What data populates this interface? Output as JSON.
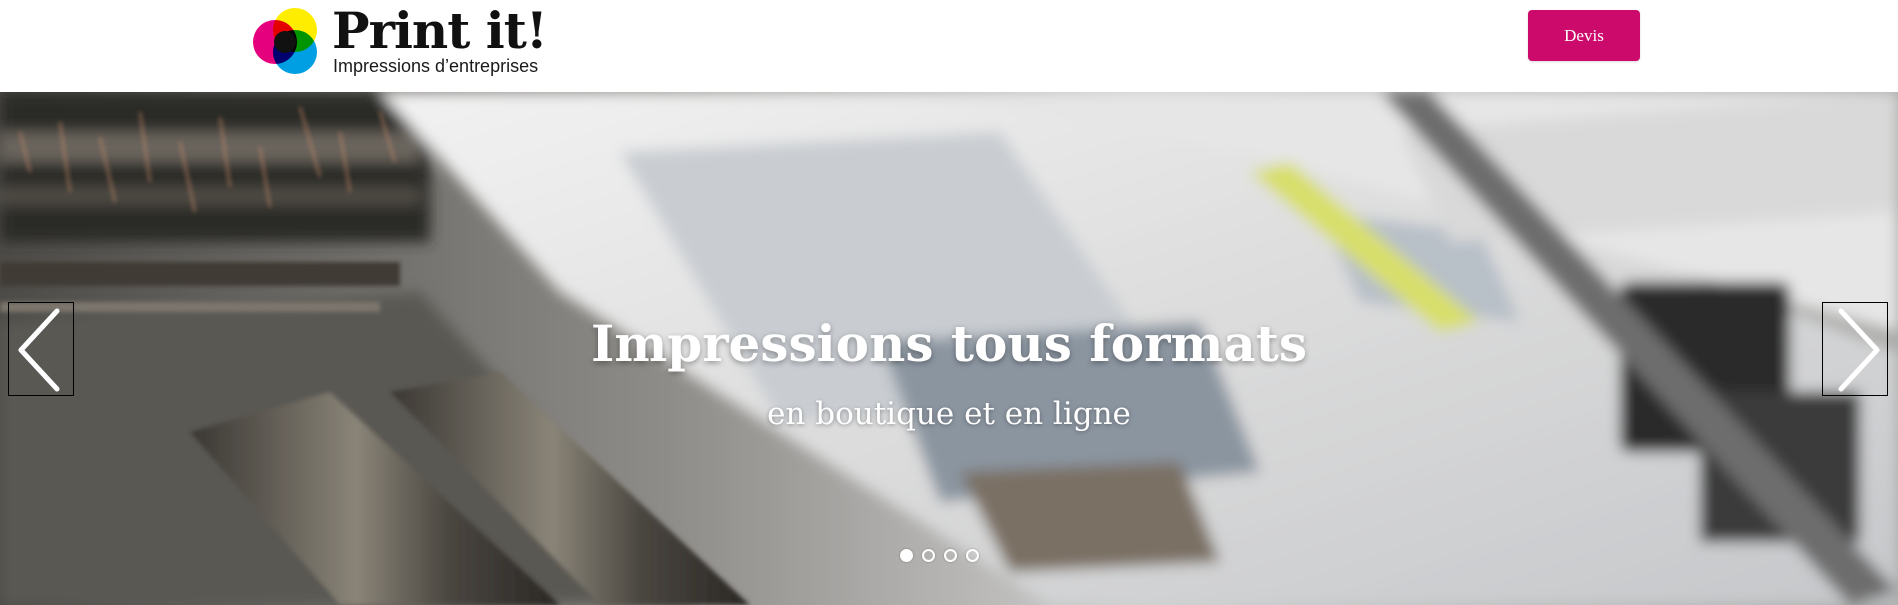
{
  "header": {
    "logo": {
      "title": "Print it!",
      "tagline": "Impressions d’entreprises",
      "colors": [
        "#e5007e",
        "#ffed00",
        "#009fe3",
        "#00963f",
        "#000000"
      ]
    },
    "devis_label": "Devis",
    "accent_color": "#cc0a6c"
  },
  "carousel": {
    "title": "Impressions tous formats",
    "subtitle": "en boutique et en ligne",
    "prev_icon": "chevron-left-icon",
    "next_icon": "chevron-right-icon",
    "slide_count": 4,
    "active_index": 0
  }
}
